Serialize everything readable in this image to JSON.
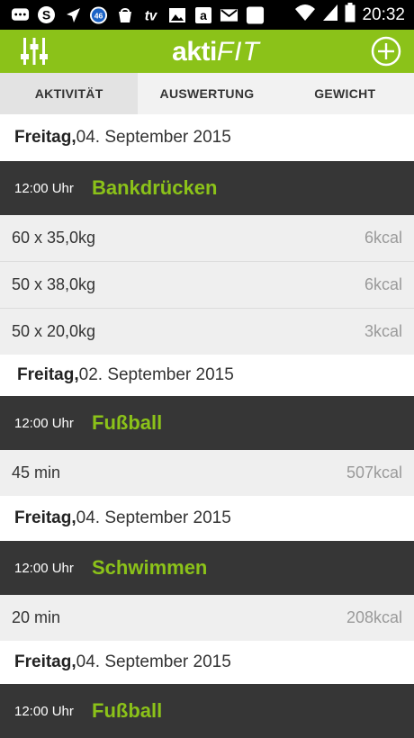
{
  "status_bar": {
    "time": "20:32",
    "badge_count": "46",
    "icons": [
      "chat-icon",
      "skype-icon",
      "navigation-icon",
      "badge-icon",
      "bag-icon",
      "tv-icon",
      "image-icon",
      "amazon-icon",
      "gmail-icon",
      "blank-icon",
      "wifi-icon",
      "signal-icon",
      "battery-icon"
    ]
  },
  "app_bar": {
    "logo_part1": "akti",
    "logo_part2": "FIT",
    "menu_icon": "sliders-icon",
    "add_icon": "add-circle-icon",
    "accent_color": "#8bc219"
  },
  "tabs": [
    {
      "label": "AKTIVITÄT",
      "active": true
    },
    {
      "label": "AUSWERTUNG",
      "active": false
    },
    {
      "label": "GEWICHT",
      "active": false
    }
  ],
  "entries": [
    {
      "day": "Freitag,",
      "date": " 04. September 2015",
      "time": "12:00 Uhr",
      "activity": "Bankdrücken",
      "rows": [
        {
          "value": "60 x 35,0kg",
          "kcal": "6kcal"
        },
        {
          "value": "50 x 38,0kg",
          "kcal": "6kcal"
        },
        {
          "value": "50 x 20,0kg",
          "kcal": "3kcal"
        }
      ]
    },
    {
      "day": "Freitag,",
      "date": " 02. September 2015",
      "time": "12:00 Uhr",
      "activity": "Fußball",
      "rows": [
        {
          "value": "45 min",
          "kcal": "507kcal"
        }
      ]
    },
    {
      "day": "Freitag,",
      "date": " 04. September 2015",
      "time": "12:00 Uhr",
      "activity": "Schwimmen",
      "rows": [
        {
          "value": "20 min",
          "kcal": "208kcal"
        }
      ]
    },
    {
      "day": "Freitag,",
      "date": " 04. September 2015",
      "time": "12:00 Uhr",
      "activity": "Fußball",
      "rows": []
    }
  ]
}
